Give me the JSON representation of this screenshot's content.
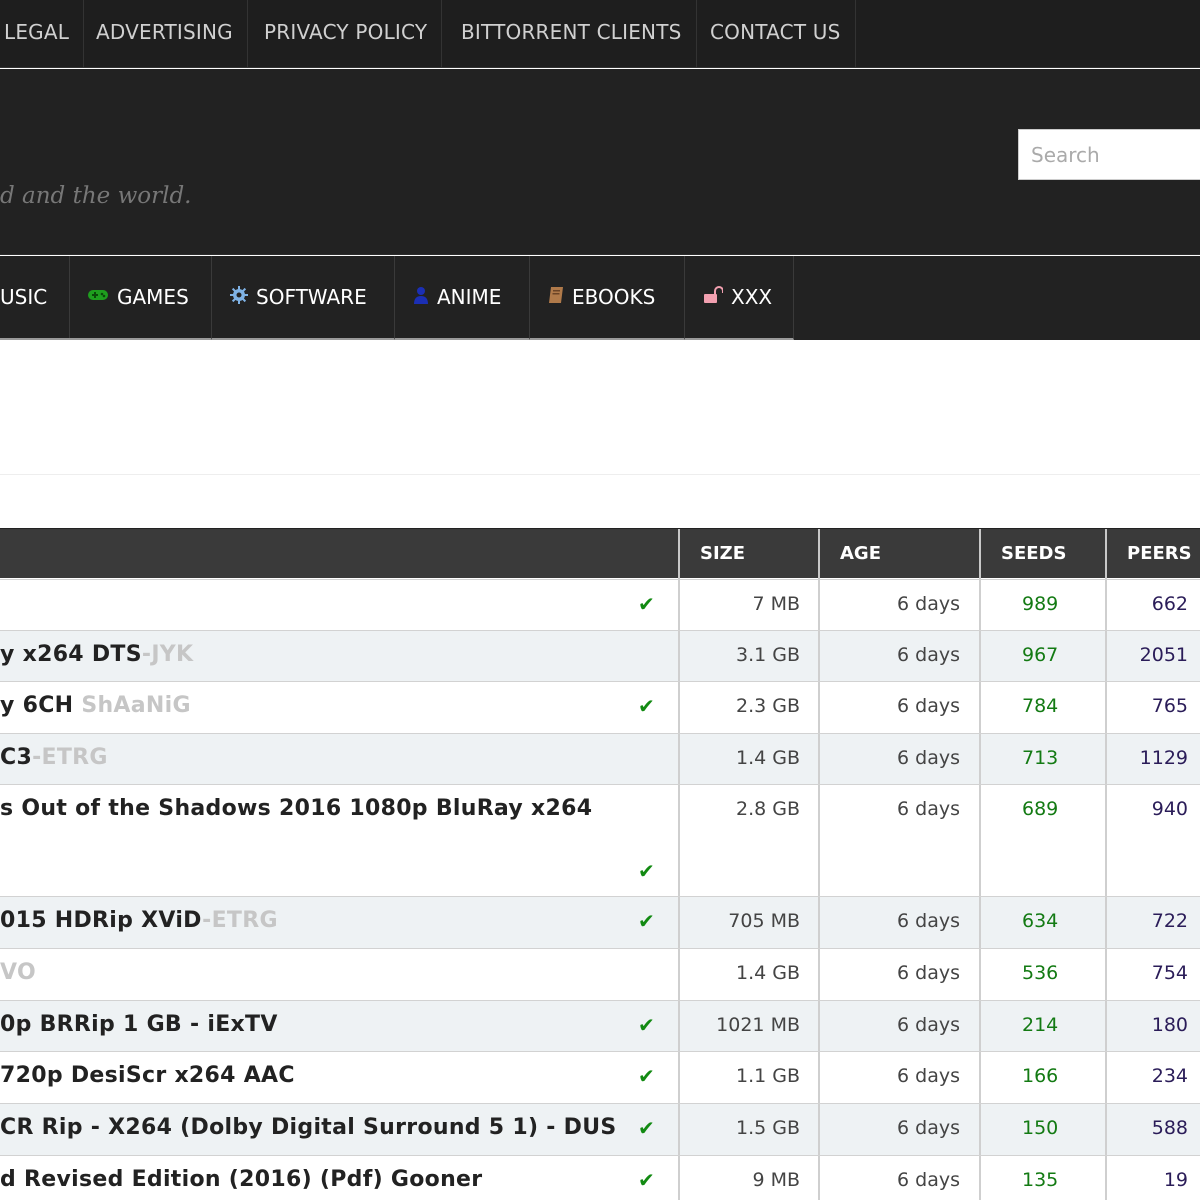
{
  "top_nav": [
    "LEGAL",
    "ADVERTISING",
    "PRIVACY POLICY",
    "BITTORRENT CLIENTS",
    "CONTACT US"
  ],
  "header": {
    "tagline": "d and the world.",
    "search_placeholder": "Search"
  },
  "categories": [
    {
      "label": "USIC",
      "icon": "music-icon"
    },
    {
      "label": "GAMES",
      "icon": "gamepad-icon",
      "color": "#1e9e1e"
    },
    {
      "label": "SOFTWARE",
      "icon": "gear-icon",
      "color": "#7fb2e5"
    },
    {
      "label": "ANIME",
      "icon": "user-icon",
      "color": "#1b2fb5"
    },
    {
      "label": "EBOOKS",
      "icon": "book-icon",
      "color": "#b07a4a"
    },
    {
      "label": "XXX",
      "icon": "unlock-icon",
      "color": "#f2a0b0"
    }
  ],
  "table": {
    "headers": {
      "size": "SIZE",
      "age": "AGE",
      "seeds": "SEEDS",
      "peers": "PEERS"
    },
    "rows": [
      {
        "name": "",
        "uploader": "",
        "verified": true,
        "size": "7 MB",
        "age": "6 days",
        "seeds": "989",
        "peers": "662"
      },
      {
        "name": "y x264 DTS",
        "uploader": "-JYK",
        "verified": false,
        "size": "3.1 GB",
        "age": "6 days",
        "seeds": "967",
        "peers": "2051"
      },
      {
        "name": "y 6CH ",
        "uploader": "ShAaNiG",
        "verified": true,
        "size": "2.3 GB",
        "age": "6 days",
        "seeds": "784",
        "peers": "765"
      },
      {
        "name": "C3",
        "uploader": "-ETRG",
        "verified": false,
        "size": "1.4 GB",
        "age": "6 days",
        "seeds": "713",
        "peers": "1129"
      },
      {
        "name": "s Out of the Shadows 2016 1080p BluRay x264",
        "uploader": "",
        "verified": true,
        "size": "2.8 GB",
        "age": "6 days",
        "seeds": "689",
        "peers": "940"
      },
      {
        "name": "015 HDRip XViD",
        "uploader": "-ETRG",
        "verified": true,
        "size": "705 MB",
        "age": "6 days",
        "seeds": "634",
        "peers": "722"
      },
      {
        "name": "",
        "uploader": "VO",
        "verified": false,
        "size": "1.4 GB",
        "age": "6 days",
        "seeds": "536",
        "peers": "754"
      },
      {
        "name": "0p BRRip 1 GB - iExTV",
        "uploader": "",
        "verified": true,
        "size": "1021 MB",
        "age": "6 days",
        "seeds": "214",
        "peers": "180"
      },
      {
        "name": " 720p DesiScr x264 AAC",
        "uploader": "",
        "verified": true,
        "size": "1.1 GB",
        "age": "6 days",
        "seeds": "166",
        "peers": "234"
      },
      {
        "name": "CR Rip - X264 (Dolby Digital Surround 5 1) - DUS",
        "uploader": "",
        "verified": true,
        "size": "1.5 GB",
        "age": "6 days",
        "seeds": "150",
        "peers": "588"
      },
      {
        "name": "d Revised Edition (2016) (Pdf) Gooner",
        "uploader": "",
        "verified": true,
        "size": "9 MB",
        "age": "6 days",
        "seeds": "135",
        "peers": "19"
      }
    ]
  },
  "colors": {
    "seeds": "#137a13",
    "peers": "#2a1c58",
    "check": "#128a12",
    "header_bg": "#222222",
    "table_head_bg": "#3a3a3a",
    "alt_row_bg": "#eef2f4"
  }
}
